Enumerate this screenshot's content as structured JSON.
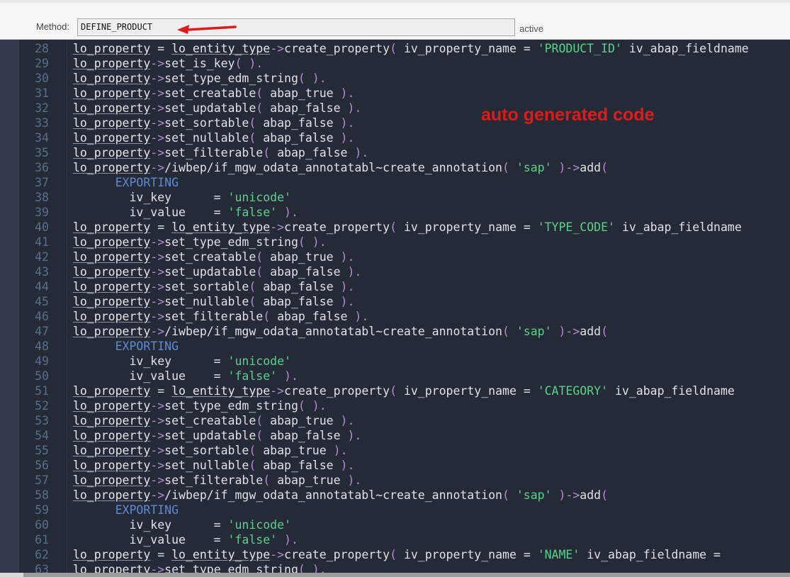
{
  "header": {
    "method_label": "Method:",
    "method_value": "DEFINE_PRODUCT",
    "status": "active"
  },
  "annotation": {
    "text": "auto generated code",
    "color": "#e01a1a"
  },
  "editor": {
    "colors": {
      "background": "#242a36",
      "line_number": "#5a6e8a",
      "string": "#5dd08c",
      "keyword": "#5f8ad0",
      "operator": "#b88ad6"
    },
    "lines": [
      {
        "n": "28",
        "t": [
          [
            "v",
            "lo_property"
          ],
          [
            "p",
            " = "
          ],
          [
            "v",
            "lo_entity_type"
          ],
          [
            "o",
            "->"
          ],
          [
            "p",
            "create_property"
          ],
          [
            "o",
            "( "
          ],
          [
            "p",
            "iv_property_name = "
          ],
          [
            "s",
            "'PRODUCT_ID'"
          ],
          [
            "p",
            " iv_abap_fieldname"
          ]
        ]
      },
      {
        "n": "29",
        "t": [
          [
            "v",
            "lo_property"
          ],
          [
            "o",
            "->"
          ],
          [
            "p",
            "set_is_key"
          ],
          [
            "o",
            "( )."
          ]
        ]
      },
      {
        "n": "30",
        "t": [
          [
            "v",
            "lo_property"
          ],
          [
            "o",
            "->"
          ],
          [
            "p",
            "set_type_edm_string"
          ],
          [
            "o",
            "( )."
          ]
        ]
      },
      {
        "n": "31",
        "t": [
          [
            "v",
            "lo_property"
          ],
          [
            "o",
            "->"
          ],
          [
            "p",
            "set_creatable"
          ],
          [
            "o",
            "( "
          ],
          [
            "p",
            "abap_true"
          ],
          [
            "o",
            " )."
          ]
        ]
      },
      {
        "n": "32",
        "t": [
          [
            "v",
            "lo_property"
          ],
          [
            "o",
            "->"
          ],
          [
            "p",
            "set_updatable"
          ],
          [
            "o",
            "( "
          ],
          [
            "p",
            "abap_false"
          ],
          [
            "o",
            " )."
          ]
        ]
      },
      {
        "n": "33",
        "t": [
          [
            "v",
            "lo_property"
          ],
          [
            "o",
            "->"
          ],
          [
            "p",
            "set_sortable"
          ],
          [
            "o",
            "( "
          ],
          [
            "p",
            "abap_false"
          ],
          [
            "o",
            " )."
          ]
        ]
      },
      {
        "n": "34",
        "t": [
          [
            "v",
            "lo_property"
          ],
          [
            "o",
            "->"
          ],
          [
            "p",
            "set_nullable"
          ],
          [
            "o",
            "( "
          ],
          [
            "p",
            "abap_false"
          ],
          [
            "o",
            " )."
          ]
        ]
      },
      {
        "n": "35",
        "t": [
          [
            "v",
            "lo_property"
          ],
          [
            "o",
            "->"
          ],
          [
            "p",
            "set_filterable"
          ],
          [
            "o",
            "( "
          ],
          [
            "p",
            "abap_false"
          ],
          [
            "o",
            " )."
          ]
        ]
      },
      {
        "n": "36",
        "t": [
          [
            "v",
            "lo_property"
          ],
          [
            "o",
            "->"
          ],
          [
            "p",
            "/iwbep/if_mgw_odata_annotatabl~create_annotation"
          ],
          [
            "o",
            "( "
          ],
          [
            "s",
            "'sap'"
          ],
          [
            "o",
            " )->"
          ],
          [
            "p",
            "add"
          ],
          [
            "o",
            "("
          ]
        ]
      },
      {
        "n": "37",
        "t": [
          [
            "p",
            "      "
          ],
          [
            "k",
            "EXPORTING"
          ]
        ]
      },
      {
        "n": "38",
        "t": [
          [
            "p",
            "        iv_key      = "
          ],
          [
            "s",
            "'unicode'"
          ]
        ]
      },
      {
        "n": "39",
        "t": [
          [
            "p",
            "        iv_value    = "
          ],
          [
            "s",
            "'false'"
          ],
          [
            "o",
            " )."
          ]
        ]
      },
      {
        "n": "40",
        "t": [
          [
            "v",
            "lo_property"
          ],
          [
            "p",
            " = "
          ],
          [
            "v",
            "lo_entity_type"
          ],
          [
            "o",
            "->"
          ],
          [
            "p",
            "create_property"
          ],
          [
            "o",
            "( "
          ],
          [
            "p",
            "iv_property_name = "
          ],
          [
            "s",
            "'TYPE_CODE'"
          ],
          [
            "p",
            " iv_abap_fieldname"
          ]
        ]
      },
      {
        "n": "41",
        "t": [
          [
            "v",
            "lo_property"
          ],
          [
            "o",
            "->"
          ],
          [
            "p",
            "set_type_edm_string"
          ],
          [
            "o",
            "( )."
          ]
        ]
      },
      {
        "n": "42",
        "t": [
          [
            "v",
            "lo_property"
          ],
          [
            "o",
            "->"
          ],
          [
            "p",
            "set_creatable"
          ],
          [
            "o",
            "( "
          ],
          [
            "p",
            "abap_true"
          ],
          [
            "o",
            " )."
          ]
        ]
      },
      {
        "n": "43",
        "t": [
          [
            "v",
            "lo_property"
          ],
          [
            "o",
            "->"
          ],
          [
            "p",
            "set_updatable"
          ],
          [
            "o",
            "( "
          ],
          [
            "p",
            "abap_false"
          ],
          [
            "o",
            " )."
          ]
        ]
      },
      {
        "n": "44",
        "t": [
          [
            "v",
            "lo_property"
          ],
          [
            "o",
            "->"
          ],
          [
            "p",
            "set_sortable"
          ],
          [
            "o",
            "( "
          ],
          [
            "p",
            "abap_false"
          ],
          [
            "o",
            " )."
          ]
        ]
      },
      {
        "n": "45",
        "t": [
          [
            "v",
            "lo_property"
          ],
          [
            "o",
            "->"
          ],
          [
            "p",
            "set_nullable"
          ],
          [
            "o",
            "( "
          ],
          [
            "p",
            "abap_false"
          ],
          [
            "o",
            " )."
          ]
        ]
      },
      {
        "n": "46",
        "t": [
          [
            "v",
            "lo_property"
          ],
          [
            "o",
            "->"
          ],
          [
            "p",
            "set_filterable"
          ],
          [
            "o",
            "( "
          ],
          [
            "p",
            "abap_false"
          ],
          [
            "o",
            " )."
          ]
        ]
      },
      {
        "n": "47",
        "t": [
          [
            "v",
            "lo_property"
          ],
          [
            "o",
            "->"
          ],
          [
            "p",
            "/iwbep/if_mgw_odata_annotatabl~create_annotation"
          ],
          [
            "o",
            "( "
          ],
          [
            "s",
            "'sap'"
          ],
          [
            "o",
            " )->"
          ],
          [
            "p",
            "add"
          ],
          [
            "o",
            "("
          ]
        ]
      },
      {
        "n": "48",
        "t": [
          [
            "p",
            "      "
          ],
          [
            "k",
            "EXPORTING"
          ]
        ]
      },
      {
        "n": "49",
        "t": [
          [
            "p",
            "        iv_key      = "
          ],
          [
            "s",
            "'unicode'"
          ]
        ]
      },
      {
        "n": "50",
        "t": [
          [
            "p",
            "        iv_value    = "
          ],
          [
            "s",
            "'false'"
          ],
          [
            "o",
            " )."
          ]
        ]
      },
      {
        "n": "51",
        "t": [
          [
            "v",
            "lo_property"
          ],
          [
            "p",
            " = "
          ],
          [
            "v",
            "lo_entity_type"
          ],
          [
            "o",
            "->"
          ],
          [
            "p",
            "create_property"
          ],
          [
            "o",
            "( "
          ],
          [
            "p",
            "iv_property_name = "
          ],
          [
            "s",
            "'CATEGORY'"
          ],
          [
            "p",
            " iv_abap_fieldname"
          ]
        ]
      },
      {
        "n": "52",
        "t": [
          [
            "v",
            "lo_property"
          ],
          [
            "o",
            "->"
          ],
          [
            "p",
            "set_type_edm_string"
          ],
          [
            "o",
            "( )."
          ]
        ]
      },
      {
        "n": "53",
        "t": [
          [
            "v",
            "lo_property"
          ],
          [
            "o",
            "->"
          ],
          [
            "p",
            "set_creatable"
          ],
          [
            "o",
            "( "
          ],
          [
            "p",
            "abap_true"
          ],
          [
            "o",
            " )."
          ]
        ]
      },
      {
        "n": "54",
        "t": [
          [
            "v",
            "lo_property"
          ],
          [
            "o",
            "->"
          ],
          [
            "p",
            "set_updatable"
          ],
          [
            "o",
            "( "
          ],
          [
            "p",
            "abap_false"
          ],
          [
            "o",
            " )."
          ]
        ]
      },
      {
        "n": "55",
        "t": [
          [
            "v",
            "lo_property"
          ],
          [
            "o",
            "->"
          ],
          [
            "p",
            "set_sortable"
          ],
          [
            "o",
            "( "
          ],
          [
            "p",
            "abap_true"
          ],
          [
            "o",
            " )."
          ]
        ]
      },
      {
        "n": "56",
        "t": [
          [
            "v",
            "lo_property"
          ],
          [
            "o",
            "->"
          ],
          [
            "p",
            "set_nullable"
          ],
          [
            "o",
            "( "
          ],
          [
            "p",
            "abap_false"
          ],
          [
            "o",
            " )."
          ]
        ]
      },
      {
        "n": "57",
        "t": [
          [
            "v",
            "lo_property"
          ],
          [
            "o",
            "->"
          ],
          [
            "p",
            "set_filterable"
          ],
          [
            "o",
            "( "
          ],
          [
            "p",
            "abap_true"
          ],
          [
            "o",
            " )."
          ]
        ]
      },
      {
        "n": "58",
        "t": [
          [
            "v",
            "lo_property"
          ],
          [
            "o",
            "->"
          ],
          [
            "p",
            "/iwbep/if_mgw_odata_annotatabl~create_annotation"
          ],
          [
            "o",
            "( "
          ],
          [
            "s",
            "'sap'"
          ],
          [
            "o",
            " )->"
          ],
          [
            "p",
            "add"
          ],
          [
            "o",
            "("
          ]
        ]
      },
      {
        "n": "59",
        "t": [
          [
            "p",
            "      "
          ],
          [
            "k",
            "EXPORTING"
          ]
        ]
      },
      {
        "n": "60",
        "t": [
          [
            "p",
            "        iv_key      = "
          ],
          [
            "s",
            "'unicode'"
          ]
        ]
      },
      {
        "n": "61",
        "t": [
          [
            "p",
            "        iv_value    = "
          ],
          [
            "s",
            "'false'"
          ],
          [
            "o",
            " )."
          ]
        ]
      },
      {
        "n": "62",
        "t": [
          [
            "v",
            "lo_property"
          ],
          [
            "p",
            " = "
          ],
          [
            "v",
            "lo_entity_type"
          ],
          [
            "o",
            "->"
          ],
          [
            "p",
            "create_property"
          ],
          [
            "o",
            "( "
          ],
          [
            "p",
            "iv_property_name = "
          ],
          [
            "s",
            "'NAME'"
          ],
          [
            "p",
            " iv_abap_fieldname ="
          ]
        ]
      },
      {
        "n": "63",
        "t": [
          [
            "v",
            "lo_property"
          ],
          [
            "o",
            "->"
          ],
          [
            "p",
            "set_type_edm_string"
          ],
          [
            "o",
            "( )."
          ]
        ]
      }
    ]
  }
}
